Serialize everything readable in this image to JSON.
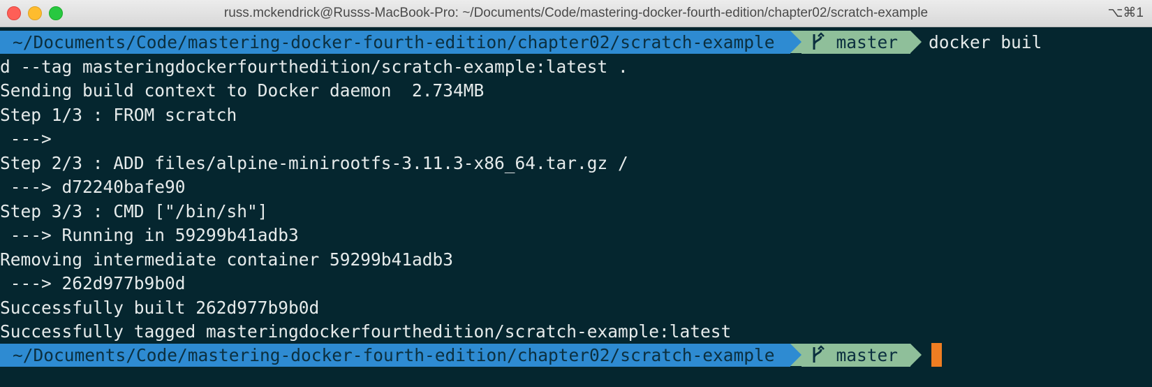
{
  "window": {
    "title": "russ.mckendrick@Russs-MacBook-Pro: ~/Documents/Code/mastering-docker-fourth-edition/chapter02/scratch-example",
    "shortcut": "⌥⌘1"
  },
  "prompt": {
    "path": "~/Documents/Code/mastering-docker-fourth-edition/chapter02/scratch-example",
    "branch": "master",
    "command_start": "docker buil"
  },
  "output": [
    "d --tag masteringdockerfourthedition/scratch-example:latest .",
    "Sending build context to Docker daemon  2.734MB",
    "Step 1/3 : FROM scratch",
    " --->",
    "Step 2/3 : ADD files/alpine-minirootfs-3.11.3-x86_64.tar.gz /",
    " ---> d72240bafe90",
    "Step 3/3 : CMD [\"/bin/sh\"]",
    " ---> Running in 59299b41adb3",
    "Removing intermediate container 59299b41adb3",
    " ---> 262d977b9b0d",
    "Successfully built 262d977b9b0d",
    "Successfully tagged masteringdockerfourthedition/scratch-example:latest"
  ],
  "colors": {
    "background": "#05262f",
    "path_segment": "#2e8bd2",
    "git_segment": "#8fbf9a",
    "cursor": "#ef7d22",
    "text": "#e6ebeb"
  },
  "icons": {
    "branch": "git-branch-icon"
  }
}
